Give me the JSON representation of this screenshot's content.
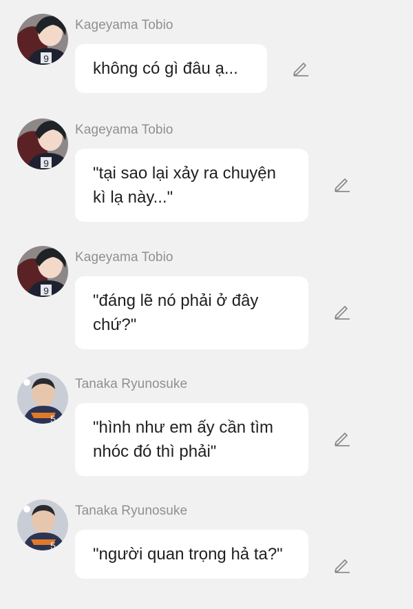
{
  "messages": [
    {
      "sender": "Kageyama Tobio",
      "text": "không có gì đâu ạ...",
      "avatar": "kageyama-avatar"
    },
    {
      "sender": "Kageyama Tobio",
      "text": "\"tại sao lại xảy ra chuyện kì lạ này...\"",
      "avatar": "kageyama-avatar"
    },
    {
      "sender": "Kageyama Tobio",
      "text": "\"đáng lẽ nó phải ở đây chứ?\"",
      "avatar": "kageyama-avatar"
    },
    {
      "sender": "Tanaka Ryunosuke",
      "text": "\"hình như em ấy cần tìm nhóc đó thì phải\"",
      "avatar": "tanaka-avatar"
    },
    {
      "sender": "Tanaka Ryunosuke",
      "text": "\"người quan trọng hả ta?\"",
      "avatar": "tanaka-avatar"
    }
  ],
  "icons": {
    "edit": "pencil-icon"
  },
  "colors": {
    "background": "#f1f1f1",
    "bubble": "#ffffff",
    "sender": "#8f8f8f",
    "text": "#1f1f1f"
  }
}
